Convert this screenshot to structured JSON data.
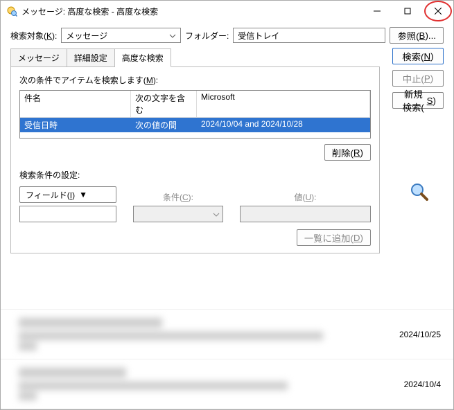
{
  "window": {
    "title": "メッセージ: 高度な検索 - 高度な検索"
  },
  "toolbar": {
    "target_label": "検索対象(",
    "target_key": "K",
    "target_label_end": "):",
    "target_value": "メッセージ",
    "folder_label": "フォルダー:",
    "folder_value": "受信トレイ",
    "browse_label": "参照(",
    "browse_key": "B",
    "browse_end": ")..."
  },
  "tabs": {
    "messages": "メッセージ",
    "advanced_settings": "詳細設定",
    "advanced_search": "高度な検索"
  },
  "criteria": {
    "instruction": "次の条件でアイテムを検索します(",
    "instruction_key": "M",
    "instruction_end": "):",
    "header": {
      "c1": "件名",
      "c2": "次の文字を含む",
      "c3": "Microsoft"
    },
    "rows": [
      {
        "c1": "受信日時",
        "c2": "次の値の間",
        "c3": "2024/10/04 and 2024/10/28"
      }
    ],
    "delete_label": "削除(",
    "delete_key": "R",
    "delete_end": ")"
  },
  "fields": {
    "section_label": "検索条件の設定:",
    "field_btn": "フィールド(",
    "field_key": "I",
    "field_end": ")",
    "condition_label": "条件(",
    "condition_key": "C",
    "condition_end": "):",
    "value_label": "値(",
    "value_key": "U",
    "value_end": "):",
    "add_label": "一覧に追加(",
    "add_key": "D",
    "add_end": ")"
  },
  "buttons": {
    "search": "検索(",
    "search_key": "N",
    "search_end": ")",
    "stop": "中止(",
    "stop_key": "P",
    "stop_end": ")",
    "new_search": "新規検索(",
    "new_search_key": "S",
    "new_search_end": ")"
  },
  "results": [
    {
      "date": "2024/10/25"
    },
    {
      "date": "2024/10/4"
    }
  ]
}
